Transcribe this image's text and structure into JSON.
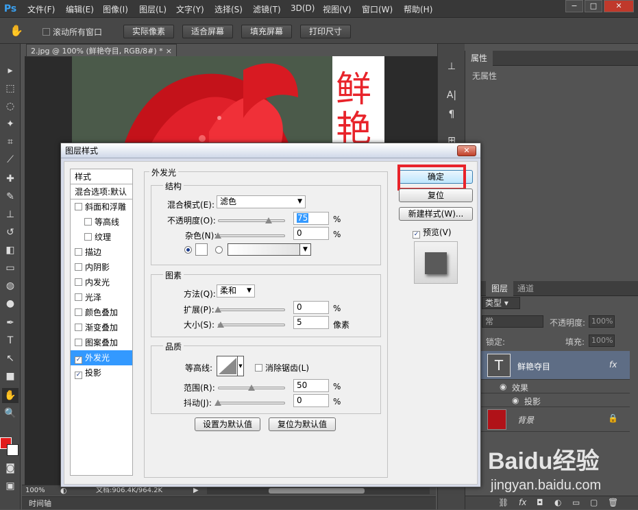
{
  "app": {
    "logo": "Ps"
  },
  "menu": [
    "文件(F)",
    "编辑(E)",
    "图像(I)",
    "图层(L)",
    "文字(Y)",
    "选择(S)",
    "滤镜(T)",
    "3D(D)",
    "视图(V)",
    "窗口(W)",
    "帮助(H)"
  ],
  "window_buttons": {
    "minimize": "−",
    "maximize": "□",
    "close": "✕"
  },
  "options": {
    "scroll_all": "滚动所有窗口",
    "buttons": [
      "实际像素",
      "适合屏幕",
      "填充屏幕",
      "打印尺寸"
    ]
  },
  "document": {
    "tab_title": "2.jpg @ 100% (鲜艳夺目, RGB/8#) *",
    "tab_close": "×",
    "canvas_text": "鲜 艳",
    "zoom": "100%",
    "doc_info": "文档:906.4K/964.2K"
  },
  "timeline": {
    "label": "时间轴"
  },
  "properties": {
    "tab": "属性",
    "content": "无属性"
  },
  "layers": {
    "tabs": [
      "图层",
      "通道"
    ],
    "filter_kind": "类型",
    "blend_mode": "常",
    "opacity_label": "不透明度:",
    "opacity_value": "100%",
    "lock_label": "锁定:",
    "fill_label": "填充:",
    "fill_value": "100%",
    "items": [
      {
        "name": "鲜艳夺目",
        "thumb": "T",
        "fx": "fx"
      },
      {
        "name": "效果"
      },
      {
        "name": "投影"
      },
      {
        "name": "背景"
      }
    ]
  },
  "dialog": {
    "title": "图层样式",
    "styles_header": "样式",
    "blend_options": "混合选项:默认",
    "style_items": [
      {
        "label": "斜面和浮雕",
        "checked": false
      },
      {
        "label": "等高线",
        "checked": false
      },
      {
        "label": "纹理",
        "checked": false
      },
      {
        "label": "描边",
        "checked": false
      },
      {
        "label": "内阴影",
        "checked": false
      },
      {
        "label": "内发光",
        "checked": false
      },
      {
        "label": "光泽",
        "checked": false
      },
      {
        "label": "颜色叠加",
        "checked": false
      },
      {
        "label": "渐变叠加",
        "checked": false
      },
      {
        "label": "图案叠加",
        "checked": false
      },
      {
        "label": "外发光",
        "checked": true
      },
      {
        "label": "投影",
        "checked": true
      }
    ],
    "section_title": "外发光",
    "structure": {
      "title": "结构",
      "blend_mode_label": "混合模式(E):",
      "blend_mode_value": "滤色",
      "opacity_label": "不透明度(O):",
      "opacity_value": "75",
      "opacity_unit": "%",
      "noise_label": "杂色(N):",
      "noise_value": "0",
      "noise_unit": "%"
    },
    "elements": {
      "title": "图素",
      "technique_label": "方法(Q):",
      "technique_value": "柔和",
      "spread_label": "扩展(P):",
      "spread_value": "0",
      "spread_unit": "%",
      "size_label": "大小(S):",
      "size_value": "5",
      "size_unit": "像素"
    },
    "quality": {
      "title": "品质",
      "contour_label": "等高线:",
      "antialias_label": "消除锯齿(L)",
      "range_label": "范围(R):",
      "range_value": "50",
      "range_unit": "%",
      "jitter_label": "抖动(J):",
      "jitter_value": "0",
      "jitter_unit": "%"
    },
    "default_buttons": {
      "set": "设置为默认值",
      "reset": "复位为默认值"
    },
    "buttons": {
      "ok": "确定",
      "cancel": "复位",
      "new_style": "新建样式(W)...",
      "preview": "预览(V)"
    },
    "slider_levels": {
      "opacity": 0.75,
      "noise": 0,
      "spread": 0,
      "size": 0.04,
      "range": 0.5,
      "jitter": 0
    }
  },
  "watermark": {
    "brand": "Baidu经验",
    "url": "jingyan.baidu.com"
  },
  "colors": {
    "highlight": "#e8232a",
    "selection": "#3399ff",
    "foreground": "#e21c1c",
    "background": "#ffffff"
  }
}
